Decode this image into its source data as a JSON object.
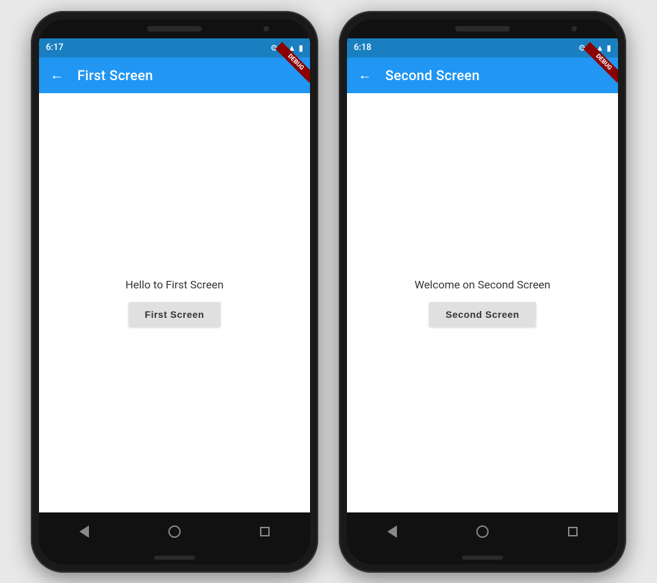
{
  "phone1": {
    "status_bar": {
      "time": "6:17",
      "icons": [
        "⚙",
        "🔋",
        "▲",
        "▶"
      ]
    },
    "app_bar": {
      "title": "First Screen",
      "back_arrow": "←"
    },
    "content": {
      "message": "Hello to First Screen",
      "button_label": "First Screen"
    },
    "debug_label": "DEBUG"
  },
  "phone2": {
    "status_bar": {
      "time": "6:18",
      "icons": [
        "⚙",
        "🔋",
        "▲",
        "▶"
      ]
    },
    "app_bar": {
      "title": "Second Screen",
      "back_arrow": "←"
    },
    "content": {
      "message": "Welcome on Second Screen",
      "button_label": "Second Screen"
    },
    "debug_label": "DEBUG"
  }
}
